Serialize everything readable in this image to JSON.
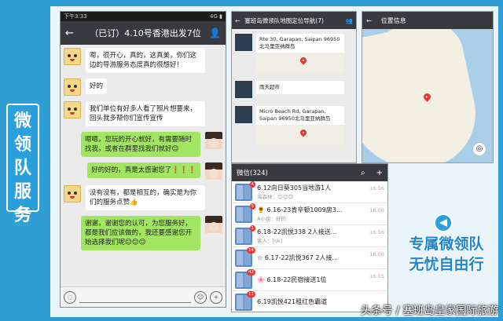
{
  "side_banner": [
    "微",
    "领",
    "队",
    "服",
    "务"
  ],
  "chat": {
    "status_time": "下午3:33",
    "status_right": "4G ▮",
    "back": "←",
    "title": "（已订）4.10号香港出发7位",
    "messages": [
      {
        "side": "left",
        "text": "嗯，很开心，真的，这真美，你们这边的导游服务态度真的很想好！"
      },
      {
        "side": "left",
        "text": "好的"
      },
      {
        "side": "left",
        "text": "我们单位有好多人看了照片想要来，回头我多帮你们宣传宣传"
      },
      {
        "side": "right",
        "text": "嗯嗯，您玩的开心就好，有需要随时找我，或者在群里找我们就好😊"
      },
      {
        "side": "right",
        "text": "好的好的，真是太感谢您了❗❗❗"
      },
      {
        "side": "left",
        "text": "没有没有，都是相互的，确实是为你们的服务点赞👍"
      },
      {
        "side": "right",
        "text": "谢谢，谢谢您的认可，为您服务好，都是我们应该做的，我还要感谢您开始选择我们呢😊😊😊"
      }
    ],
    "input_icons": [
      "◌",
      "☺",
      "+"
    ]
  },
  "group": {
    "back": "←",
    "title": "塞班岛微领队地图定位导航(7)",
    "locations": [
      {
        "address": "Rte 30, Garapan, Saipan 96950北马里亚纳群岛",
        "has_map": true
      },
      {
        "address": "雨天超市",
        "has_map": false
      },
      {
        "address": "Micro Beach Rd, Garapan, Saipan 96950北马里亚纳群岛",
        "has_map": true
      }
    ]
  },
  "map": {
    "back": "←",
    "title": "位置信息",
    "gps_icon": "◎"
  },
  "wechat": {
    "title": "微信(324)",
    "search_icon": "⌕",
    "add_icon": "+",
    "rows": [
      {
        "badge": "4",
        "name": "6.12向日葵305当地游1人",
        "sub": "海森林：😊😊😊",
        "time": "16:06"
      },
      {
        "badge": "5",
        "name": "🌻 6.16-23肯辛顿1009房3...",
        "sub": "A小姐：好的",
        "time": "16:06"
      },
      {
        "badge": "1",
        "name": "6.18-22凯悦338 2人接送...",
        "sub": "客人：[ok]",
        "time": "16:06"
      },
      {
        "badge": "14",
        "name": "☆ 6.17-22凯悦367 2人接...",
        "sub": "",
        "time": "16:06"
      },
      {
        "badge": "42",
        "name": "🌸 6.18-22民宿接送1位",
        "sub": "",
        "time": "16:05"
      },
      {
        "badge": "11",
        "name": "6.19凯悦421租红色霸道",
        "sub": "",
        "time": ""
      }
    ]
  },
  "promo": {
    "line1": "专属微领队",
    "line2": "无忧自由行"
  },
  "watermark": "头条号 / 塞班岛皇家国际旅游"
}
